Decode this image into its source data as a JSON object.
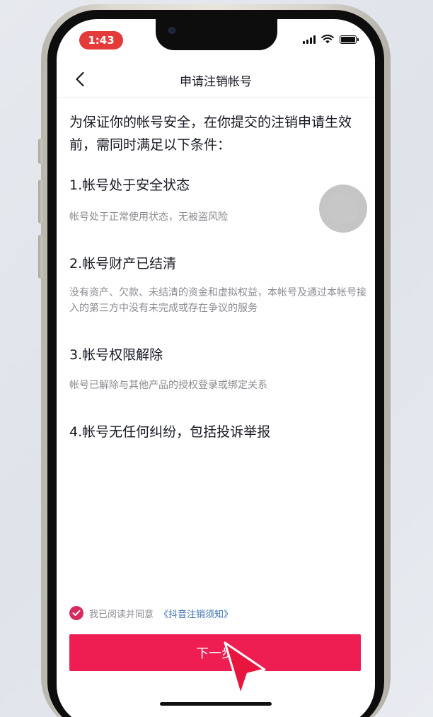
{
  "status_bar": {
    "time": "1:43"
  },
  "navbar": {
    "title": "申请注销帐号"
  },
  "intro": {
    "text": "为保证你的帐号安全，在你提交的注销申请生效前，需同时满足以下条件："
  },
  "conditions": [
    {
      "title": "1.帐号处于安全状态",
      "desc": "帐号处于正常使用状态，无被盗风险"
    },
    {
      "title": "2.帐号财产已结清",
      "desc": "没有资产、欠款、未结清的资金和虚拟权益，本帐号及通过本帐号接入的第三方中没有未完成或存在争议的服务"
    },
    {
      "title": "3.帐号权限解除",
      "desc": "帐号已解除与其他产品的授权登录或绑定关系"
    },
    {
      "title": "4.帐号无任何纠纷，包括投诉举报",
      "desc": ""
    }
  ],
  "agreement": {
    "text": "我已阅读并同意",
    "link": "《抖音注销须知》",
    "checked": true
  },
  "next_button": {
    "label": "下一步"
  },
  "colors": {
    "primary": "#ee1d52",
    "check": "#d62b5f",
    "link": "#3a6fb3",
    "time_pill": "#e43a3a"
  },
  "icons": [
    "back-icon",
    "signal-icon",
    "wifi-icon",
    "battery-icon",
    "check-icon",
    "pointer-cursor-icon"
  ]
}
